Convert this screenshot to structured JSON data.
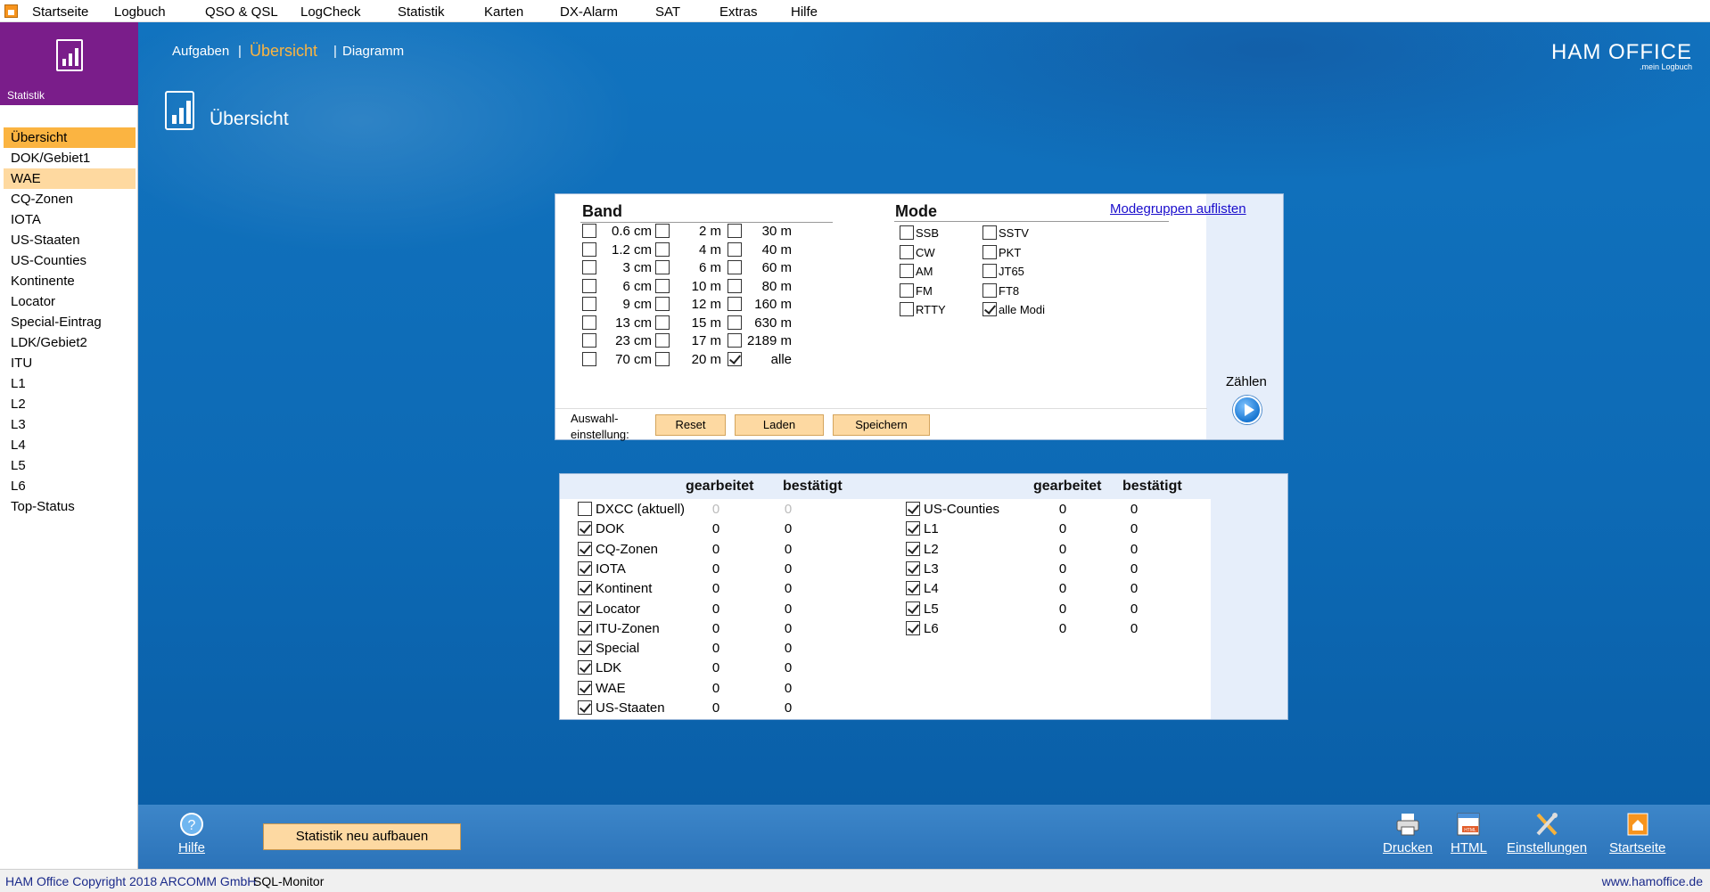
{
  "menu": [
    "Startseite",
    "Logbuch",
    "QSO & QSL",
    "LogCheck",
    "Statistik",
    "Karten",
    "DX-Alarm",
    "SAT",
    "Extras",
    "Hilfe"
  ],
  "sidebar": {
    "title": "Statistik",
    "items": [
      "Übersicht",
      "DOK/Gebiet1",
      "WAE",
      "CQ-Zonen",
      "IOTA",
      "US-Staaten",
      "US-Counties",
      "Kontinente",
      "Locator",
      "Special-Eintrag",
      "LDK/Gebiet2",
      "ITU",
      "L1",
      "L2",
      "L3",
      "L4",
      "L5",
      "L6",
      "Top-Status"
    ]
  },
  "breadcrumb": {
    "first": "Aufgaben",
    "current": "Übersicht",
    "last": "Diagramm",
    "sep": "|"
  },
  "logo": {
    "main": "HAM OFFICE",
    "sub": ".mein Logbuch"
  },
  "page_title": "Übersicht",
  "band": {
    "title": "Band",
    "col1": [
      "0.6 cm",
      "1.2 cm",
      "3 cm",
      "6 cm",
      "9 cm",
      "13 cm",
      "23 cm",
      "70 cm"
    ],
    "col2": [
      "2 m",
      "4 m",
      "6 m",
      "10 m",
      "12 m",
      "15 m",
      "17 m",
      "20 m"
    ],
    "col3": [
      "30 m",
      "40 m",
      "60 m",
      "80 m",
      "160 m",
      "630 m",
      "2189 m",
      "alle"
    ],
    "checked_col3_last": true
  },
  "mode": {
    "title": "Mode",
    "link": "Modegruppen auflisten",
    "col1": [
      "SSB",
      "CW",
      "AM",
      "FM",
      "RTTY"
    ],
    "col2": [
      "SSTV",
      "PKT",
      "JT65",
      "FT8",
      "alle Modi"
    ]
  },
  "auswahl": {
    "label1": "Auswahl-",
    "label2": "einstellung:",
    "reset": "Reset",
    "laden": "Laden",
    "speichern": "Speichern"
  },
  "zaehlen": "Zählen",
  "counts": {
    "h_worked": "gearbeitet",
    "h_confirmed": "bestätigt",
    "left": [
      {
        "name": "DXCC (aktuell)",
        "checked": false,
        "w": "0",
        "c": "0"
      },
      {
        "name": "DOK",
        "checked": true,
        "w": "0",
        "c": "0"
      },
      {
        "name": "CQ-Zonen",
        "checked": true,
        "w": "0",
        "c": "0"
      },
      {
        "name": "IOTA",
        "checked": true,
        "w": "0",
        "c": "0"
      },
      {
        "name": "Kontinent",
        "checked": true,
        "w": "0",
        "c": "0"
      },
      {
        "name": "Locator",
        "checked": true,
        "w": "0",
        "c": "0"
      },
      {
        "name": "ITU-Zonen",
        "checked": true,
        "w": "0",
        "c": "0"
      },
      {
        "name": "Special",
        "checked": true,
        "w": "0",
        "c": "0"
      },
      {
        "name": "LDK",
        "checked": true,
        "w": "0",
        "c": "0"
      },
      {
        "name": "WAE",
        "checked": true,
        "w": "0",
        "c": "0"
      },
      {
        "name": "US-Staaten",
        "checked": true,
        "w": "0",
        "c": "0"
      }
    ],
    "right": [
      {
        "name": "US-Counties",
        "checked": true,
        "w": "0",
        "c": "0"
      },
      {
        "name": "L1",
        "checked": true,
        "w": "0",
        "c": "0"
      },
      {
        "name": "L2",
        "checked": true,
        "w": "0",
        "c": "0"
      },
      {
        "name": "L3",
        "checked": true,
        "w": "0",
        "c": "0"
      },
      {
        "name": "L4",
        "checked": true,
        "w": "0",
        "c": "0"
      },
      {
        "name": "L5",
        "checked": true,
        "w": "0",
        "c": "0"
      },
      {
        "name": "L6",
        "checked": true,
        "w": "0",
        "c": "0"
      }
    ]
  },
  "bottom": {
    "hilfe": "Hilfe",
    "rebuild": "Statistik neu aufbauen",
    "drucken": "Drucken",
    "html": "HTML",
    "einstellungen": "Einstellungen",
    "startseite": "Startseite"
  },
  "status": {
    "copyright": "HAM Office Copyright 2018 ARCOMM GmbH",
    "sql": "SQL-Monitor",
    "url": "www.hamoffice.de"
  },
  "colors": {
    "accent": "#fbb441",
    "sidebar_head": "#7a1d8a",
    "main_bg": "#0d6ab5"
  }
}
